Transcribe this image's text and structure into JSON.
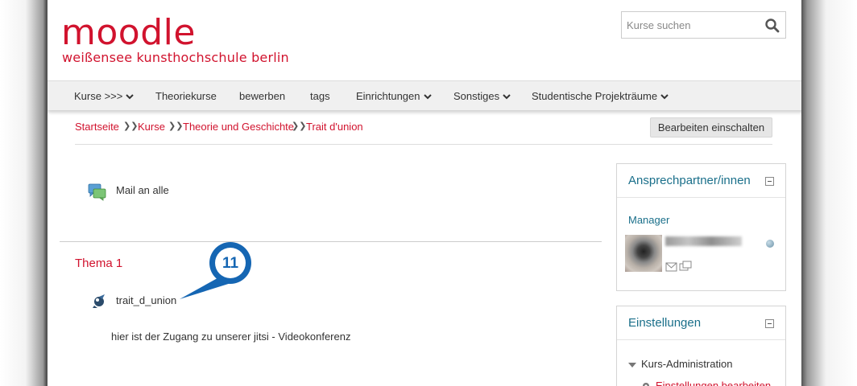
{
  "header": {
    "logo_main": "moodle",
    "logo_sub": "weißensee kunsthochschule berlin"
  },
  "search": {
    "placeholder": "Kurse suchen"
  },
  "nav": {
    "items": [
      {
        "label": "Kurse >>>",
        "dropdown": true
      },
      {
        "label": "Theoriekurse",
        "dropdown": false
      },
      {
        "label": "bewerben",
        "dropdown": false
      },
      {
        "label": "tags",
        "dropdown": false
      },
      {
        "label": "Einrichtungen",
        "dropdown": true
      },
      {
        "label": "Sonstiges",
        "dropdown": true
      },
      {
        "label": "Studentische Projekträume",
        "dropdown": true
      }
    ]
  },
  "breadcrumb": {
    "items": [
      "Startseite",
      "Kurse",
      "Theorie und Geschichte",
      "Trait d'union"
    ]
  },
  "edit_button": "Bearbeiten einschalten",
  "main": {
    "mail_label": "Mail an alle",
    "section_title": "Thema 1",
    "activity_label": "trait_d_union",
    "callout_number": "11",
    "description": "hier ist der Zugang zu unserer jitsi - Videokonferenz"
  },
  "contacts_block": {
    "title": "Ansprechpartner/innen",
    "role": "Manager"
  },
  "settings_block": {
    "title": "Einstellungen",
    "admin_label": "Kurs-Administration",
    "settings_link": "Einstellungen bearbeiten"
  },
  "colors": {
    "accent": "#d1132e",
    "block_title": "#1a6f8a",
    "callout": "#1566b3"
  }
}
